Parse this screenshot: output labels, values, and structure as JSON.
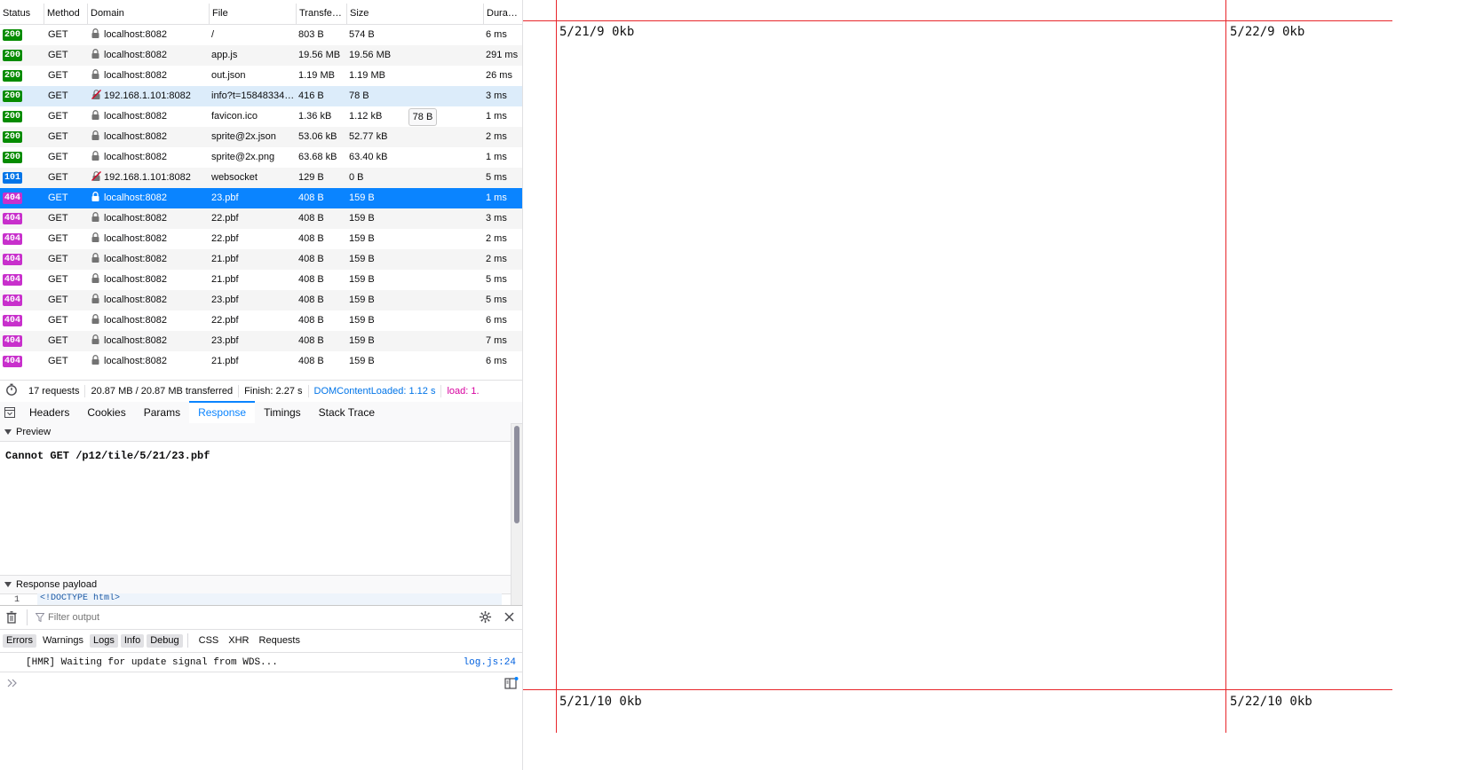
{
  "network": {
    "columns": [
      "Status",
      "Method",
      "Domain",
      "File",
      "Transfe…",
      "Size",
      "Dura…"
    ],
    "rows": [
      {
        "status": "200",
        "kind": "ok",
        "method": "GET",
        "secure": true,
        "domain": "localhost:8082",
        "file": "/",
        "transferred": "803 B",
        "size": "574 B",
        "duration": "6 ms"
      },
      {
        "status": "200",
        "kind": "ok",
        "method": "GET",
        "secure": true,
        "domain": "localhost:8082",
        "file": "app.js",
        "transferred": "19.56 MB",
        "size": "19.56 MB",
        "duration": "291 ms"
      },
      {
        "status": "200",
        "kind": "ok",
        "method": "GET",
        "secure": true,
        "domain": "localhost:8082",
        "file": "out.json",
        "transferred": "1.19 MB",
        "size": "1.19 MB",
        "duration": "26 ms"
      },
      {
        "status": "200",
        "kind": "ok",
        "method": "GET",
        "secure": false,
        "domain": "192.168.1.101:8082",
        "file": "info?t=15848334…",
        "transferred": "416 B",
        "size": "78 B",
        "duration": "3 ms"
      },
      {
        "status": "200",
        "kind": "ok",
        "method": "GET",
        "secure": true,
        "domain": "localhost:8082",
        "file": "favicon.ico",
        "transferred": "1.36 kB",
        "size": "1.12 kB",
        "duration": "1 ms"
      },
      {
        "status": "200",
        "kind": "ok",
        "method": "GET",
        "secure": true,
        "domain": "localhost:8082",
        "file": "sprite@2x.json",
        "transferred": "53.06 kB",
        "size": "52.77 kB",
        "duration": "2 ms"
      },
      {
        "status": "200",
        "kind": "ok",
        "method": "GET",
        "secure": true,
        "domain": "localhost:8082",
        "file": "sprite@2x.png",
        "transferred": "63.68 kB",
        "size": "63.40 kB",
        "duration": "1 ms"
      },
      {
        "status": "101",
        "kind": "info",
        "method": "GET",
        "secure": false,
        "domain": "192.168.1.101:8082",
        "file": "websocket",
        "transferred": "129 B",
        "size": "0 B",
        "duration": "5 ms"
      },
      {
        "status": "404",
        "kind": "err",
        "method": "GET",
        "secure": true,
        "domain": "localhost:8082",
        "file": "23.pbf",
        "transferred": "408 B",
        "size": "159 B",
        "duration": "1 ms"
      },
      {
        "status": "404",
        "kind": "err",
        "method": "GET",
        "secure": true,
        "domain": "localhost:8082",
        "file": "22.pbf",
        "transferred": "408 B",
        "size": "159 B",
        "duration": "3 ms"
      },
      {
        "status": "404",
        "kind": "err",
        "method": "GET",
        "secure": true,
        "domain": "localhost:8082",
        "file": "22.pbf",
        "transferred": "408 B",
        "size": "159 B",
        "duration": "2 ms"
      },
      {
        "status": "404",
        "kind": "err",
        "method": "GET",
        "secure": true,
        "domain": "localhost:8082",
        "file": "21.pbf",
        "transferred": "408 B",
        "size": "159 B",
        "duration": "2 ms"
      },
      {
        "status": "404",
        "kind": "err",
        "method": "GET",
        "secure": true,
        "domain": "localhost:8082",
        "file": "21.pbf",
        "transferred": "408 B",
        "size": "159 B",
        "duration": "5 ms"
      },
      {
        "status": "404",
        "kind": "err",
        "method": "GET",
        "secure": true,
        "domain": "localhost:8082",
        "file": "23.pbf",
        "transferred": "408 B",
        "size": "159 B",
        "duration": "5 ms"
      },
      {
        "status": "404",
        "kind": "err",
        "method": "GET",
        "secure": true,
        "domain": "localhost:8082",
        "file": "22.pbf",
        "transferred": "408 B",
        "size": "159 B",
        "duration": "6 ms"
      },
      {
        "status": "404",
        "kind": "err",
        "method": "GET",
        "secure": true,
        "domain": "localhost:8082",
        "file": "23.pbf",
        "transferred": "408 B",
        "size": "159 B",
        "duration": "7 ms"
      },
      {
        "status": "404",
        "kind": "err",
        "method": "GET",
        "secure": true,
        "domain": "localhost:8082",
        "file": "21.pbf",
        "transferred": "408 B",
        "size": "159 B",
        "duration": "6 ms"
      }
    ],
    "selected_row": 8,
    "hovered_row": 3,
    "tooltip": "78 B",
    "status_colors": {
      "ok": "#058b00",
      "info": "#0074e8",
      "err": "#c830cc"
    }
  },
  "summary": {
    "requests": "17 requests",
    "transferred": "20.87 MB / 20.87 MB transferred",
    "finish": "Finish: 2.27 s",
    "dom": "DOMContentLoaded: 1.12 s",
    "load": "load: 1."
  },
  "details": {
    "tabs": [
      "Headers",
      "Cookies",
      "Params",
      "Response",
      "Timings",
      "Stack Trace"
    ],
    "active_tab": "Response",
    "preview_label": "Preview",
    "preview_text": "Cannot GET /p12/tile/5/21/23.pbf",
    "payload_label": "Response payload",
    "payload_line_no": "1",
    "payload_line": "<!DOCTYPE html>"
  },
  "console": {
    "filter_placeholder": "Filter output",
    "filters": [
      "Errors",
      "Warnings",
      "Logs",
      "Info",
      "Debug"
    ],
    "filters_on": [
      "Errors",
      "Logs",
      "Info",
      "Debug"
    ],
    "extra_filters": [
      "CSS",
      "XHR",
      "Requests"
    ],
    "message": "[HMR] Waiting for update signal from WDS...",
    "source": "log.js:24"
  },
  "map": {
    "labels": [
      "5/21/9 0kb",
      "5/22/9 0kb",
      "5/21/10 0kb",
      "5/22/10 0kb"
    ],
    "grid_color": "#e8262b"
  }
}
